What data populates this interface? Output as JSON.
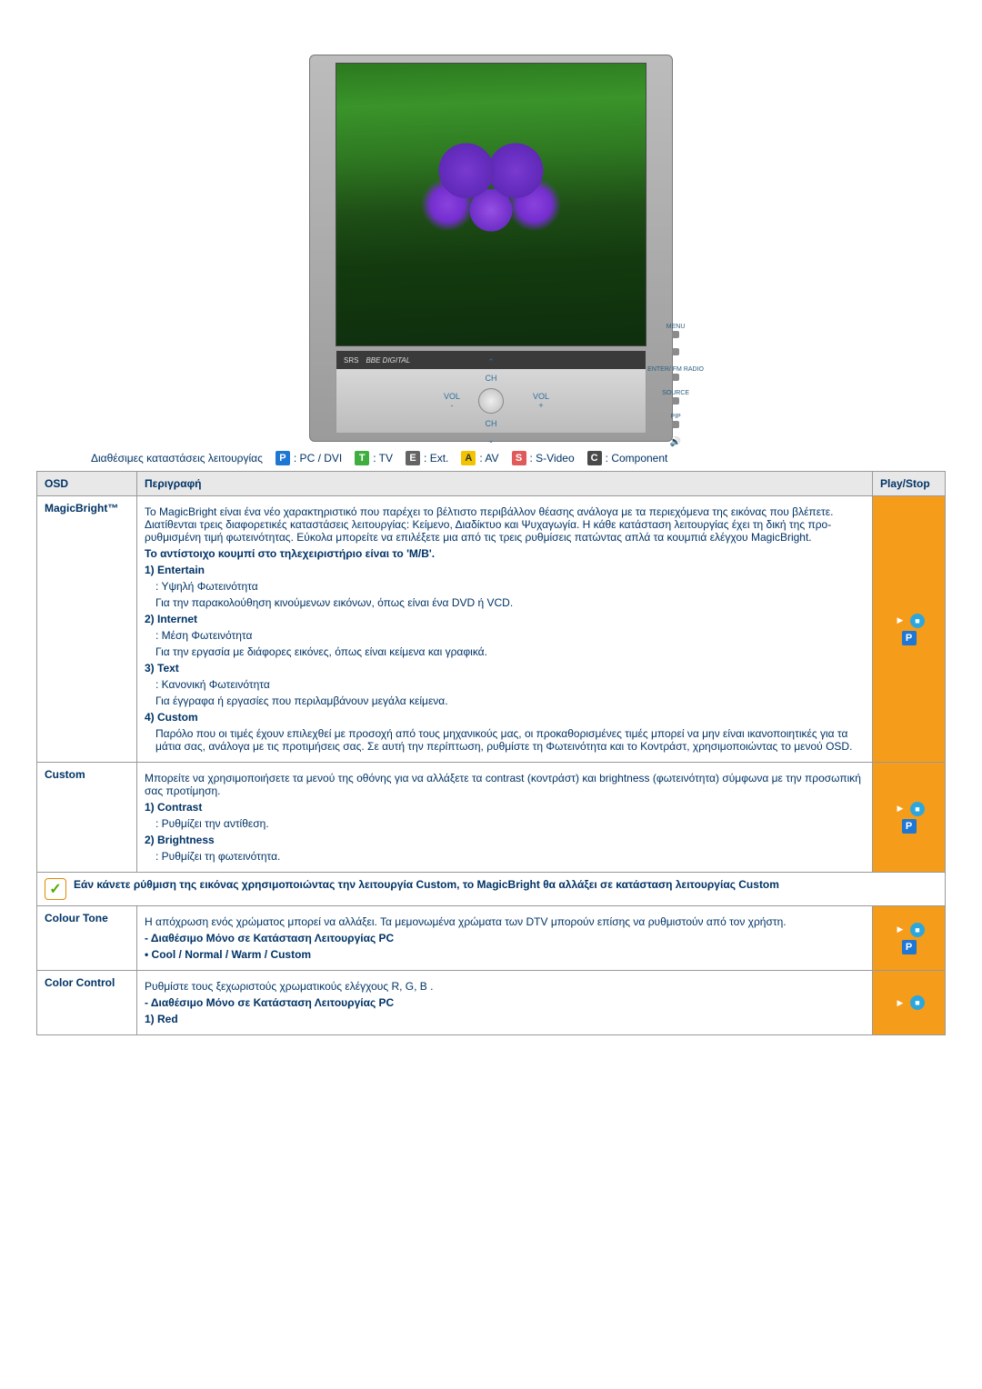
{
  "modes": {
    "label": "Διαθέσιμες καταστάσεις λειτουργίας",
    "p": "P",
    "p_label": ": PC / DVI",
    "t": "T",
    "t_label": ": TV",
    "e": "E",
    "e_label": ": Ext.",
    "a": "A",
    "a_label": ": AV",
    "s": "S",
    "s_label": ": S-Video",
    "c": "C",
    "c_label": ": Component"
  },
  "headers": {
    "osd": "OSD",
    "desc": "Περιγραφή",
    "play": "Play/Stop"
  },
  "rows": {
    "magicbright": {
      "name": "MagicBright™",
      "intro": "Το MagicBright είναι ένα νέο χαρακτηριστικό που παρέχει το βέλτιστο περιβάλλον θέασης ανάλογα με τα περιεχόμενα της εικόνας που βλέπετε. Διατίθενται τρεις διαφορετικές καταστάσεις λειτουργίας: Κείμενο, Διαδίκτυο και Ψυχαγωγία. Η κάθε κατάσταση λειτουργίας έχει τη δική της προ-ρυθμισμένη τιμή φωτεινότητας. Εύκολα μπορείτε να επιλέξετε μια από τις τρεις ρυθμίσεις πατώντας απλά τα κουμπιά ελέγχου MagicBright.",
      "remote_note": "Το αντίστοιχο κουμπί στο τηλεχειριστήριο είναι το 'M/B'.",
      "i1_title": "1) Entertain",
      "i1_a": ": Υψηλή Φωτεινότητα",
      "i1_b": "Για την παρακολούθηση κινούμενων εικόνων, όπως είναι ένα DVD ή VCD.",
      "i2_title": "2) Internet",
      "i2_a": ": Μέση Φωτεινότητα",
      "i2_b": "Για την εργασία με διάφορες εικόνες, όπως είναι κείμενα και γραφικά.",
      "i3_title": "3) Text",
      "i3_a": ": Κανονική Φωτεινότητα",
      "i3_b": "Για έγγραφα ή εργασίες που περιλαμβάνουν μεγάλα κείμενα.",
      "i4_title": "4) Custom",
      "i4_a": "Παρόλο που οι τιμές έχουν επιλεχθεί με προσοχή από τους μηχανικούς μας, οι προκαθορισμένες τιμές μπορεί να μην είναι ικανοποιητικές για τα μάτια σας, ανάλογα με τις προτιμήσεις σας. Σε αυτή την περίπτωση, ρυθμίστε τη Φωτεινότητα και το Κοντράστ, χρησιμοποιώντας το μενού OSD."
    },
    "custom": {
      "name": "Custom",
      "intro": "Μπορείτε να χρησιμοποιήσετε τα μενού της οθόνης για να αλλάξετε τα contrast (κοντράστ) και brightness (φωτεινότητα) σύμφωνα με την προσωπική σας προτίμηση.",
      "i1_title": "1) Contrast",
      "i1_a": ": Ρυθμίζει την αντίθεση.",
      "i2_title": "2) Brightness",
      "i2_a": ": Ρυθμίζει τη φωτεινότητα."
    },
    "colour_tone": {
      "name": "Colour Tone",
      "intro": "Η απόχρωση ενός χρώματος μπορεί να αλλάξει. Τα μεμονωμένα χρώματα των DTV μπορούν επίσης να ρυθμιστούν από τον χρήστη.",
      "n1": "- Διαθέσιμο Μόνο σε Κατάσταση Λειτουργίας PC",
      "n2": "• Cool / Normal / Warm / Custom"
    },
    "color_control": {
      "name": "Color Control",
      "intro": "Ρυθμίστε τους ξεχωριστούς χρωματικούς ελέγχους R, G, B .",
      "n1": "- Διαθέσιμο Μόνο σε Κατάσταση Λειτουργίας PC",
      "i1_title": "1) Red"
    }
  },
  "note_text": "Εάν κάνετε ρύθμιση της εικόνας χρησιμοποιώντας την λειτουργία Custom, το MagicBright θα αλλάξει σε κατάσταση λειτουργίας Custom",
  "side_buttons": {
    "menu": "MENU",
    "enter": "ENTER/\nFM RADIO",
    "source": "SOURCE",
    "pip": "PIP"
  },
  "ctrl": {
    "ch_up": "CH",
    "ch_down": "CH",
    "vol_minus": "VOL\n-",
    "vol_plus": "VOL\n+"
  },
  "icons": {
    "p_badge": "P"
  }
}
